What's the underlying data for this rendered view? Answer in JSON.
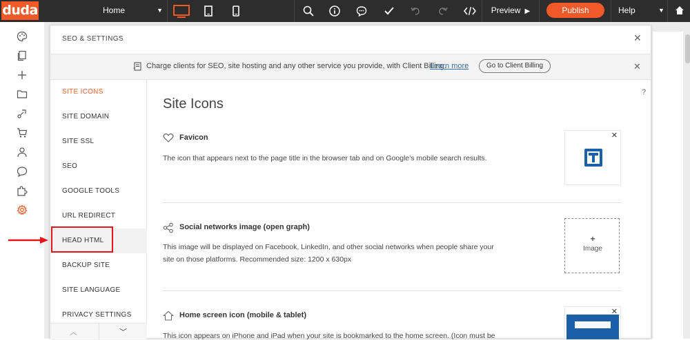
{
  "topbar": {
    "logo": "duda",
    "page_select": "Home",
    "preview_label": "Preview",
    "publish_label": "Publish",
    "help_label": "Help"
  },
  "panel": {
    "title": "SEO & SETTINGS",
    "banner": {
      "text": "Charge clients for SEO, site hosting and any other service you provide, with Client Billing.",
      "link": "Learn more",
      "button": "Go to Client Billing"
    },
    "nav": [
      {
        "label": "SITE ICONS",
        "active": true
      },
      {
        "label": "SITE DOMAIN"
      },
      {
        "label": "SITE SSL"
      },
      {
        "label": "SEO"
      },
      {
        "label": "GOOGLE TOOLS"
      },
      {
        "label": "URL REDIRECT"
      },
      {
        "label": "HEAD HTML",
        "highlighted": true
      },
      {
        "label": "BACKUP SITE"
      },
      {
        "label": "SITE LANGUAGE"
      },
      {
        "label": "PRIVACY SETTINGS"
      }
    ],
    "content": {
      "help": "?",
      "title": "Site Icons",
      "sections": [
        {
          "title": "Favicon",
          "desc": "The icon that appears next to the page title in the browser tab and on Google's mobile search results."
        },
        {
          "title": "Social networks image (open graph)",
          "desc": "This image will be displayed on Facebook, LinkedIn, and other social networks when people share your site on those platforms. Recommended size: 1200 x 630px",
          "placeholder": "Image"
        },
        {
          "title": "Home screen icon (mobile & tablet)",
          "desc": "This icon appears on iPhone and iPad when your site is bookmarked to the home screen. (Icon must be"
        }
      ]
    }
  },
  "colors": {
    "accent": "#f05a28",
    "topbar": "#2d2d2d",
    "active_nav": "#e8632c",
    "annotation": "#e3161b",
    "favicon_blue": "#1a5fa8"
  }
}
